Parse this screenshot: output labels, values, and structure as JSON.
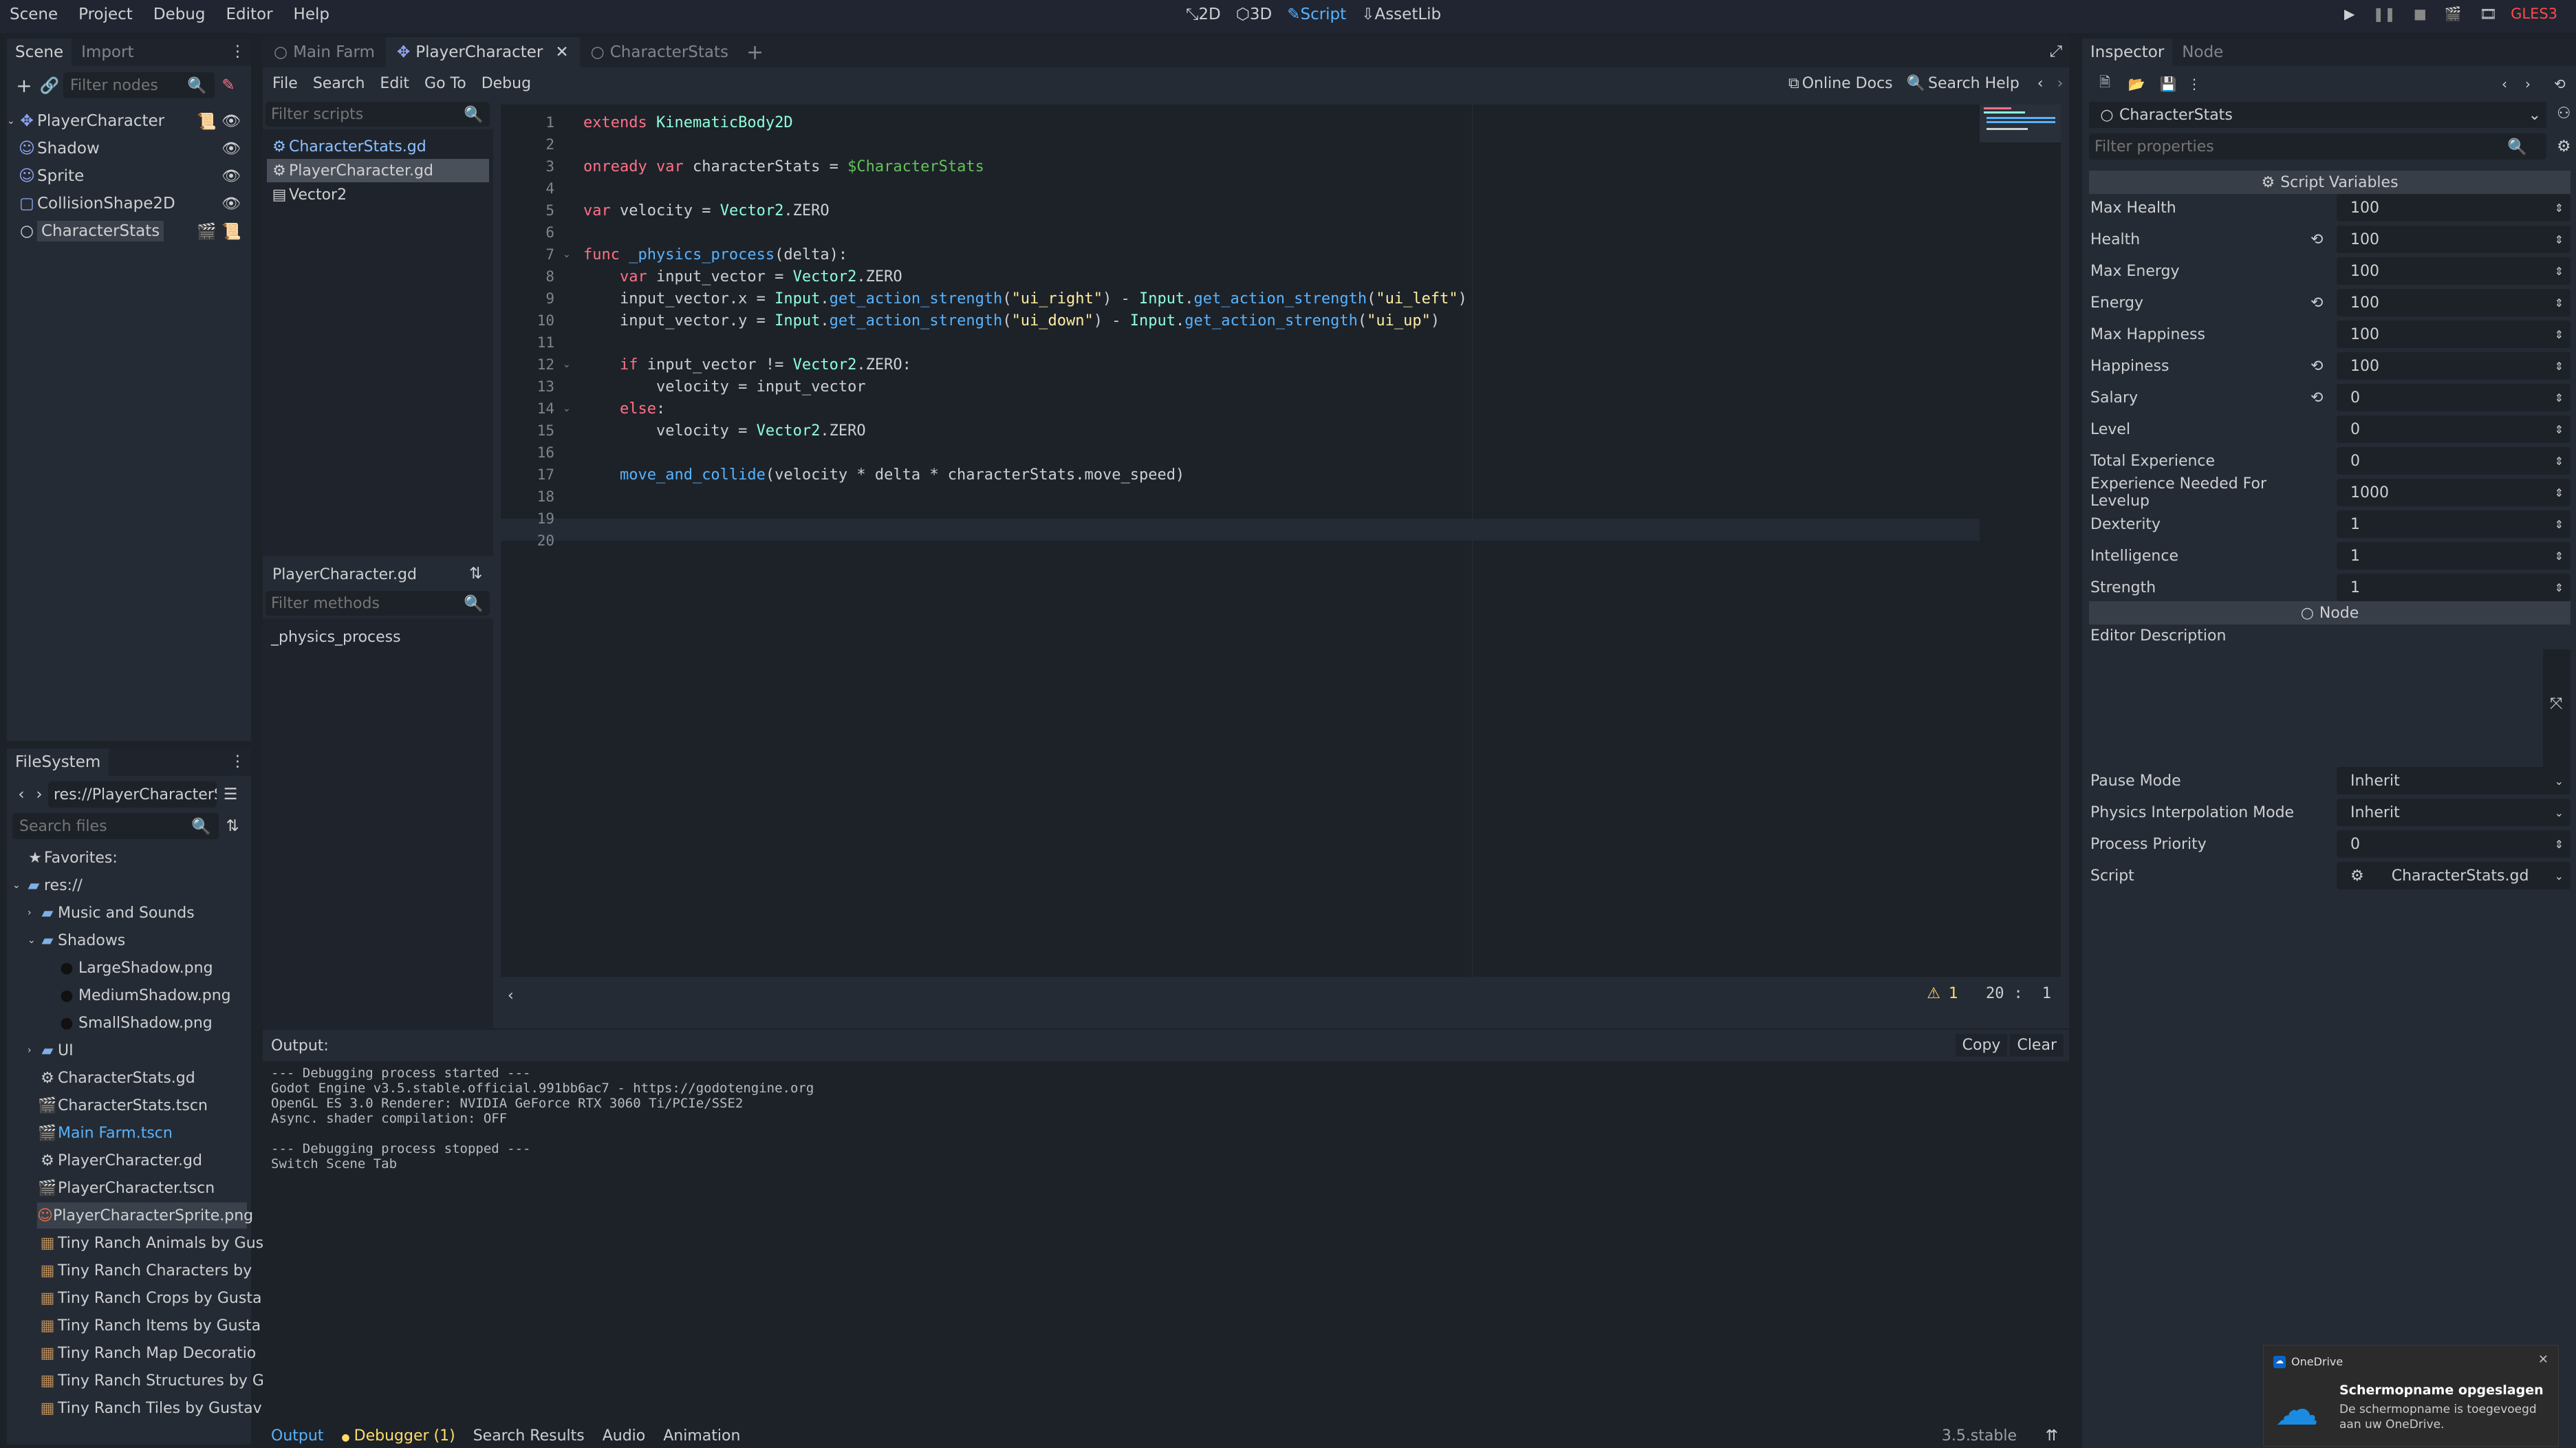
{
  "menubar": {
    "items": [
      "Scene",
      "Project",
      "Debug",
      "Editor",
      "Help"
    ],
    "workspaces": {
      "w2d": "2D",
      "w3d": "3D",
      "script": "Script",
      "assetlib": "AssetLib"
    },
    "renderer": "GLES3"
  },
  "scene_dock": {
    "tabs": [
      "Scene",
      "Import"
    ],
    "filter_placeholder": "Filter nodes",
    "nodes": [
      {
        "label": "PlayerCharacter"
      },
      {
        "label": "Shadow"
      },
      {
        "label": "Sprite"
      },
      {
        "label": "CollisionShape2D"
      },
      {
        "label": "CharacterStats"
      }
    ]
  },
  "filesystem": {
    "tab": "FileSystem",
    "path": "res://PlayerCharacterS",
    "search_placeholder": "Search files",
    "favorites": "Favorites:",
    "items": [
      {
        "label": "res://"
      },
      {
        "label": "Music and Sounds"
      },
      {
        "label": "Shadows"
      },
      {
        "label": "LargeShadow.png"
      },
      {
        "label": "MediumShadow.png"
      },
      {
        "label": "SmallShadow.png"
      },
      {
        "label": "UI"
      },
      {
        "label": "CharacterStats.gd"
      },
      {
        "label": "CharacterStats.tscn"
      },
      {
        "label": "Main Farm.tscn"
      },
      {
        "label": "PlayerCharacter.gd"
      },
      {
        "label": "PlayerCharacter.tscn"
      },
      {
        "label": "PlayerCharacterSprite.png"
      },
      {
        "label": "Tiny Ranch Animals by Gus"
      },
      {
        "label": "Tiny Ranch Characters by"
      },
      {
        "label": "Tiny Ranch Crops by Gusta"
      },
      {
        "label": "Tiny Ranch Items by Gusta"
      },
      {
        "label": "Tiny Ranch Map Decoratio"
      },
      {
        "label": "Tiny Ranch Structures by G"
      },
      {
        "label": "Tiny Ranch Tiles by Gustav"
      }
    ]
  },
  "editor_tabs": [
    "Main Farm",
    "PlayerCharacter",
    "CharacterStats"
  ],
  "script_menu": {
    "items": [
      "File",
      "Search",
      "Edit",
      "Go To",
      "Debug"
    ],
    "online_docs": "Online Docs",
    "search_help": "Search Help"
  },
  "script_list": {
    "filter_placeholder": "Filter scripts",
    "items": [
      "CharacterStats.gd",
      "PlayerCharacter.gd",
      "Vector2"
    ],
    "current": "PlayerCharacter.gd",
    "methods_placeholder": "Filter methods",
    "methods": [
      "_physics_process"
    ]
  },
  "code": {
    "line_numbers": [
      "1",
      "2",
      "3",
      "4",
      "5",
      "6",
      "7",
      "8",
      "9",
      "10",
      "11",
      "12",
      "13",
      "14",
      "15",
      "16",
      "17",
      "18",
      "19",
      "20"
    ],
    "lines": [
      "extends KinematicBody2D",
      "",
      "onready var characterStats = $CharacterStats",
      "",
      "var velocity = Vector2.ZERO",
      "",
      "func _physics_process(delta):",
      "    var input_vector = Vector2.ZERO",
      "    input_vector.x = Input.get_action_strength(\"ui_right\") - Input.get_action_strength(\"ui_left\")",
      "    input_vector.y = Input.get_action_strength(\"ui_down\") - Input.get_action_strength(\"ui_up\")",
      "",
      "    if input_vector != Vector2.ZERO:",
      "        velocity = input_vector",
      "    else:",
      "        velocity = Vector2.ZERO",
      "",
      "    move_and_collide(velocity * delta * characterStats.move_speed)",
      "",
      "",
      ""
    ],
    "status": {
      "warnings": "1",
      "line": "20",
      "sep": ":",
      "col": "1"
    }
  },
  "output": {
    "title": "Output:",
    "copy": "Copy",
    "clear": "Clear",
    "log": [
      "--- Debugging process started ---",
      "Godot Engine v3.5.stable.official.991bb6ac7 - https://godotengine.org",
      "OpenGL ES 3.0 Renderer: NVIDIA GeForce RTX 3060 Ti/PCIe/SSE2",
      "Async. shader compilation: OFF",
      "",
      "--- Debugging process stopped ---",
      "Switch Scene Tab"
    ]
  },
  "bottom_tabs": [
    "Output",
    "Debugger (1)",
    "Search Results",
    "Audio",
    "Animation"
  ],
  "version": "3.5.stable",
  "inspector": {
    "tabs": [
      "Inspector",
      "Node"
    ],
    "object": "CharacterStats",
    "filter_placeholder": "Filter properties",
    "section_script": "Script Variables",
    "properties": [
      {
        "label": "Max Health",
        "value": "100"
      },
      {
        "label": "Health",
        "value": "100"
      },
      {
        "label": "Max Energy",
        "value": "100"
      },
      {
        "label": "Energy",
        "value": "100"
      },
      {
        "label": "Max Happiness",
        "value": "100"
      },
      {
        "label": "Happiness",
        "value": "100"
      },
      {
        "label": "Salary",
        "value": "0"
      },
      {
        "label": "Level",
        "value": "0"
      },
      {
        "label": "Total Experience",
        "value": "0"
      },
      {
        "label": "Experience Needed For Levelup",
        "value": "1000"
      },
      {
        "label": "Dexterity",
        "value": "1"
      },
      {
        "label": "Intelligence",
        "value": "1"
      },
      {
        "label": "Strength",
        "value": "1"
      }
    ],
    "section_node": "Node",
    "editor_description": "Editor Description",
    "node_props": [
      {
        "label": "Pause Mode",
        "value": "Inherit"
      },
      {
        "label": "Physics Interpolation Mode",
        "value": "Inherit"
      },
      {
        "label": "Process Priority",
        "value": "0"
      },
      {
        "label": "Script",
        "value": "CharacterStats.gd"
      }
    ]
  },
  "toast": {
    "app": "OneDrive",
    "title": "Schermopname opgeslagen",
    "body": "De schermopname is toegevoegd aan uw OneDrive."
  }
}
